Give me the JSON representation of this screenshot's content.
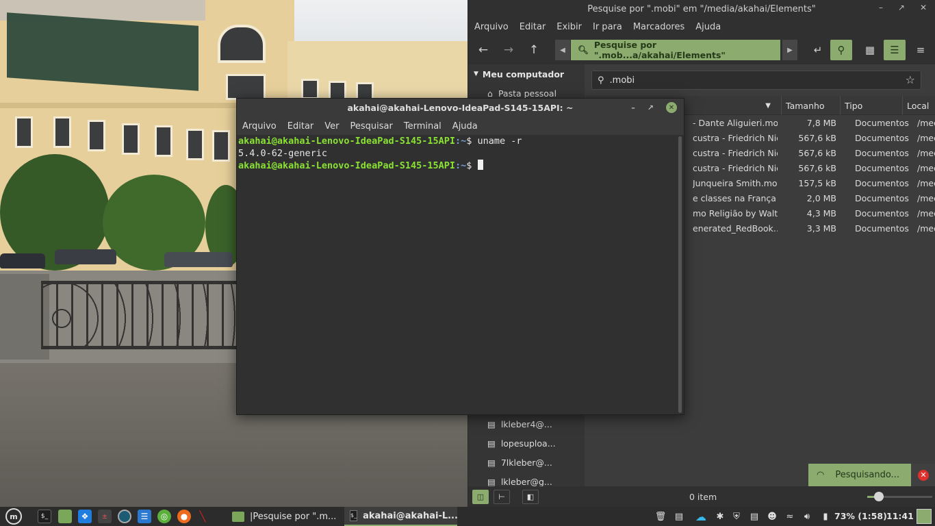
{
  "filemanager": {
    "title": "Pesquise por \".mobi\" em \"/media/akahai/Elements\"",
    "menu": [
      "Arquivo",
      "Editar",
      "Exibir",
      "Ir para",
      "Marcadores",
      "Ajuda"
    ],
    "location_label": "Pesquise por \".mob...a/akahai/Elements\"",
    "sidebar": {
      "header": "Meu computador",
      "items": [
        "Pasta pessoal"
      ],
      "network_items": [
        "lkleber4@...",
        "lopesuploa...",
        "7lkleber@...",
        "lkleber@g..."
      ]
    },
    "search_query": ".mobi",
    "columns": [
      "Tamanho",
      "Tipo",
      "Local"
    ],
    "rows": [
      {
        "name": "- Dante Aliguieri.mobi",
        "size": "7,8 MB",
        "type": "Documentos",
        "location": "/media"
      },
      {
        "name": "custra - Friedrich Nie…",
        "size": "567,6 kB",
        "type": "Documentos",
        "location": "/media"
      },
      {
        "name": "custra - Friedrich Nie…",
        "size": "567,6 kB",
        "type": "Documentos",
        "location": "/media"
      },
      {
        "name": "custra - Friedrich Nie…",
        "size": "567,6 kB",
        "type": "Documentos",
        "location": "/media"
      },
      {
        "name": "Junqueira Smith.mobi",
        "size": "157,5 kB",
        "type": "Documentos",
        "location": "/media"
      },
      {
        "name": "e classes na França (…",
        "size": "2,0 MB",
        "type": "Documentos",
        "location": "/media"
      },
      {
        "name": "mo Religião by Walt…",
        "size": "4,3 MB",
        "type": "Documentos",
        "location": "/media"
      },
      {
        "name": "enerated_RedBook…",
        "size": "3,3 MB",
        "type": "Documentos",
        "location": "/media"
      }
    ],
    "status_text": "0 item",
    "searching_label": "Pesquisando...",
    "zoom_level": 0.18
  },
  "terminal": {
    "title": "akahai@akahai-Lenovo-IdeaPad-S145-15API: ~",
    "menu": [
      "Arquivo",
      "Editar",
      "Ver",
      "Pesquisar",
      "Terminal",
      "Ajuda"
    ],
    "prompt_user": "akahai@akahai-Lenovo-IdeaPad-S145-15API",
    "prompt_path": ":~",
    "prompt_symbol": "$ ",
    "command": "uname -r",
    "output": "5.4.0-62-generic"
  },
  "taskbar": {
    "tasks": [
      {
        "label": "|Pesquise por \".m..."
      },
      {
        "label": "akahai@akahai-L..."
      }
    ],
    "battery": "73% (1:58)",
    "clock": "11:41"
  },
  "colors": {
    "accent": "#8cab6f",
    "prompt_green": "#8ae234",
    "prompt_blue": "#729fcf",
    "close_red": "#e0302c"
  }
}
